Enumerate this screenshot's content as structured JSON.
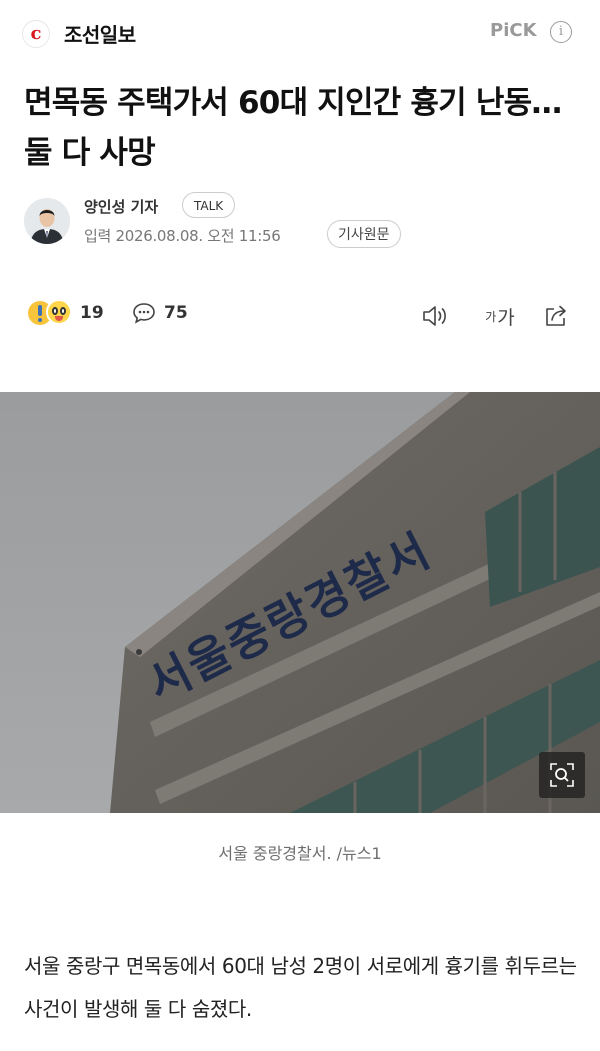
{
  "header": {
    "publisher": "조선일보",
    "logo_glyph": "c",
    "pick_label": "PiCK",
    "info_icon": "i"
  },
  "article": {
    "headline": "면목동 주택가서 60대 지인간 흉기 난동… 둘 다 사망",
    "author": "양인성 기자",
    "talk_label": "TALK",
    "published": "입력 2026.08.08. 오전 11:56",
    "original_label": "기사원문",
    "reaction_count": "19",
    "comment_count": "75",
    "font_label_small": "가",
    "font_label_large": "가",
    "photo_sign": "서울중랑경찰서",
    "photo_caption": "서울 중랑경찰서. /뉴스1",
    "body": "서울 중랑구 면목동에서 60대 남성 2명이 서로에게 흉기를 휘두르는 사건이 발생해 둘 다 숨졌다."
  },
  "colors": {
    "brand_red": "#d71920",
    "muted_gray": "#9a9a9a"
  }
}
